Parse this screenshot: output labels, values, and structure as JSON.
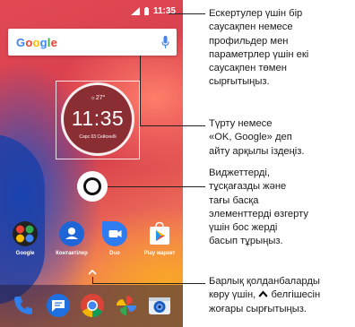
{
  "status_bar": {
    "time": "11:35"
  },
  "search": {
    "logo": [
      "G",
      "o",
      "o",
      "g",
      "l",
      "e"
    ]
  },
  "clock_widget": {
    "weather": "☼27°",
    "time": "11:35",
    "date": "Сәрс 03 Сейсенбі"
  },
  "apps": [
    {
      "label": "Google",
      "icon": "google-folder-icon"
    },
    {
      "label": "Контактілер",
      "icon": "contacts-icon"
    },
    {
      "label": "Duo",
      "icon": "duo-icon"
    },
    {
      "label": "Play маркет",
      "icon": "play-store-icon"
    }
  ],
  "dock": [
    {
      "icon": "phone-icon"
    },
    {
      "icon": "messages-icon"
    },
    {
      "icon": "chrome-icon"
    },
    {
      "icon": "photos-icon"
    },
    {
      "icon": "camera-icon"
    }
  ],
  "callouts": {
    "swipe_down": {
      "line1": "Ескертулер үшін бір",
      "line2": "саусақпен немесе",
      "line3": "профильдер мен",
      "line4": "параметрлер үшін екі",
      "line5": "саусақпен төмен",
      "line6": "сырғытыңыз."
    },
    "search": {
      "line1": "Түрту немесе",
      "line2": "«OK, Google» деп",
      "line3": "айту арқылы іздеңіз."
    },
    "hold": {
      "line1": "Виджеттерді,",
      "line2": "тұсқағазды және",
      "line3": "тағы басқа",
      "line4": "элементтерді өзгерту",
      "line5": "үшін бос жерді",
      "line6": "басып тұрыңыз."
    },
    "all_apps": {
      "line1": "Барлық қолданбаларды",
      "line2_pre": "көру үшін,",
      "line2_post": "белгішесін",
      "line3": "жоғары сырғытыңыз."
    }
  },
  "colors": {
    "accent_red": "#d63a4a",
    "callout_line": "#222222"
  }
}
